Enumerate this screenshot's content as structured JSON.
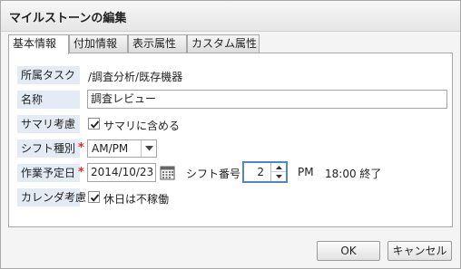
{
  "dialog": {
    "title": "マイルストーンの編集"
  },
  "tabs": [
    {
      "label": "基本情報",
      "active": true
    },
    {
      "label": "付加情報",
      "active": false
    },
    {
      "label": "表示属性",
      "active": false
    },
    {
      "label": "カスタム属性",
      "active": false
    }
  ],
  "form": {
    "task_label": "所属タスク",
    "task_value": "/調査分析/既存機器",
    "name_label": "名称",
    "name_value": "調査レビュー",
    "summary_label": "サマリ考慮",
    "summary_checkbox_label": "サマリに含める",
    "summary_checked": true,
    "shift_type_label": "シフト種別",
    "shift_type_value": "AM/PM",
    "required_mark": "*",
    "date_label": "作業予定日",
    "date_value": "2014/10/23",
    "shift_number_label": "シフト番号",
    "shift_number_value": "2",
    "shift_period": "PM",
    "end_time_text": "18:00 終了",
    "calendar_label": "カレンダ考慮",
    "calendar_checkbox_label": "休日は不稼働",
    "calendar_checked": true
  },
  "buttons": {
    "ok": "OK",
    "cancel": "キャンセル"
  },
  "colors": {
    "label_bg": "#e4ebf5",
    "required": "#d03030",
    "focus_border": "#4f86c8"
  },
  "icons": {
    "calendar": "calendar-icon",
    "checkmark": "checkmark-icon",
    "dropdown": "chevron-down-icon"
  }
}
